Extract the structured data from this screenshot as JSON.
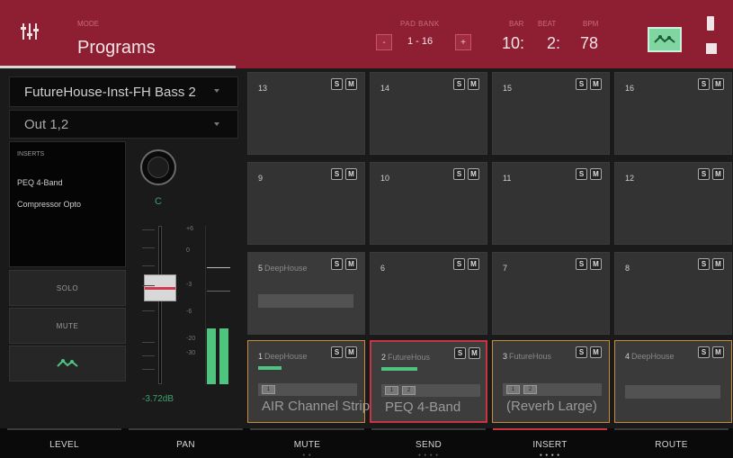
{
  "header": {
    "mode_label": "MODE",
    "title": "Programs",
    "bank_label": "PAD BANK",
    "bank_prev": "-",
    "bank_range": "1 - 16",
    "bank_next": "+",
    "bar_label": "BAR",
    "bar_value": "10:",
    "beat_label": "BEAT",
    "beat_value": "2:",
    "bpm_label": "BPM",
    "bpm_value": "78",
    "automation_icon": "automation-icon"
  },
  "left": {
    "program_name": "FutureHouse-Inst-FH Bass 2",
    "output": "Out 1,2",
    "inserts_label": "INSERTS",
    "inserts": [
      "PEQ 4-Band",
      "Compressor Opto"
    ],
    "solo_label": "SOLO",
    "mute_label": "MUTE",
    "pan_value": "C",
    "fader_value": "-3.72dB",
    "scale": [
      "+6",
      "0",
      "-3",
      "-6",
      "-20",
      "-30"
    ],
    "meter_level": 0.35
  },
  "pads": [
    {
      "num": "13",
      "name": "",
      "solo": "S",
      "mute": "M"
    },
    {
      "num": "14",
      "name": "",
      "solo": "S",
      "mute": "M"
    },
    {
      "num": "15",
      "name": "",
      "solo": "S",
      "mute": "M"
    },
    {
      "num": "16",
      "name": "",
      "solo": "S",
      "mute": "M"
    },
    {
      "num": "9",
      "name": "",
      "solo": "S",
      "mute": "M"
    },
    {
      "num": "10",
      "name": "",
      "solo": "S",
      "mute": "M"
    },
    {
      "num": "11",
      "name": "",
      "solo": "S",
      "mute": "M"
    },
    {
      "num": "12",
      "name": "",
      "solo": "S",
      "mute": "M"
    },
    {
      "num": "5",
      "name": "DeepHouse",
      "solo": "S",
      "mute": "M"
    },
    {
      "num": "6",
      "name": "",
      "solo": "S",
      "mute": "M"
    },
    {
      "num": "7",
      "name": "",
      "solo": "S",
      "mute": "M"
    },
    {
      "num": "8",
      "name": "",
      "solo": "S",
      "mute": "M"
    },
    {
      "num": "1",
      "name": "DeepHouse",
      "solo": "S",
      "mute": "M",
      "plugin": "AIR Channel Strip",
      "slots": [
        "1"
      ]
    },
    {
      "num": "2",
      "name": "FutureHous",
      "solo": "S",
      "mute": "M",
      "plugin": "PEQ 4-Band",
      "slots": [
        "1",
        "2"
      ]
    },
    {
      "num": "3",
      "name": "FutureHous",
      "solo": "S",
      "mute": "M",
      "plugin": "(Reverb Large)",
      "slots": [
        "1",
        "2"
      ]
    },
    {
      "num": "4",
      "name": "DeepHouse",
      "solo": "S",
      "mute": "M"
    }
  ],
  "tabs": [
    {
      "label": "LEVEL"
    },
    {
      "label": "PAN"
    },
    {
      "label": "MUTE"
    },
    {
      "label": "SEND"
    },
    {
      "label": "INSERT"
    },
    {
      "label": "ROUTE"
    }
  ],
  "colors": {
    "header_bg": "#8e1f33",
    "accent": "#c8343f",
    "meter": "#4fc47f"
  }
}
